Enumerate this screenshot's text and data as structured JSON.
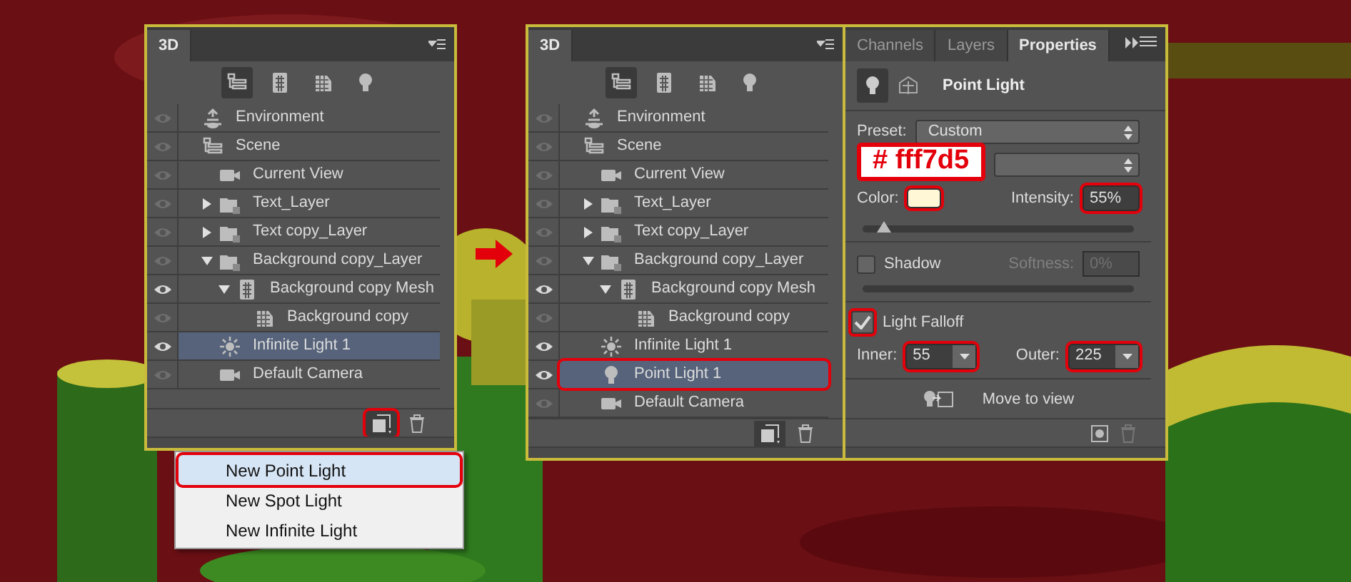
{
  "left_panel": {
    "tab": "3D",
    "filters": [
      {
        "kind": "scene",
        "selected": true
      },
      {
        "kind": "mesh",
        "selected": false
      },
      {
        "kind": "material",
        "selected": false
      },
      {
        "kind": "light",
        "selected": false
      }
    ],
    "items": [
      {
        "label": "Environment",
        "kind": "environment",
        "visible": false,
        "selected": false
      },
      {
        "label": "Scene",
        "kind": "scene",
        "visible": false,
        "selected": false,
        "children": [
          {
            "label": "Current View",
            "kind": "camera",
            "visible": false,
            "selected": false
          },
          {
            "label": "Text_Layer",
            "kind": "layer",
            "visible": false,
            "selected": false,
            "expanded": false
          },
          {
            "label": "Text copy_Layer",
            "kind": "layer",
            "visible": false,
            "selected": false,
            "expanded": false
          },
          {
            "label": "Background copy_Layer",
            "kind": "layer",
            "visible": false,
            "selected": false,
            "expanded": true,
            "children": [
              {
                "label": "Background copy Mesh",
                "kind": "mesh",
                "visible": true,
                "selected": false,
                "expanded": true,
                "children": [
                  {
                    "label": "Background copy",
                    "kind": "material",
                    "visible": false,
                    "selected": false
                  }
                ]
              }
            ]
          },
          {
            "label": "Infinite Light 1",
            "kind": "infinite-light",
            "visible": true,
            "selected": true
          },
          {
            "label": "Default Camera",
            "kind": "camera",
            "visible": false,
            "selected": false
          }
        ]
      }
    ],
    "new_light_highlighted": true,
    "menu": [
      {
        "label": "New Point Light",
        "selected": true,
        "highlighted": true
      },
      {
        "label": "New Spot Light",
        "selected": false,
        "highlighted": false
      },
      {
        "label": "New Infinite Light",
        "selected": false,
        "highlighted": false
      }
    ]
  },
  "middle_panel": {
    "tab": "3D",
    "filters": [
      {
        "kind": "scene",
        "selected": true
      },
      {
        "kind": "mesh",
        "selected": false
      },
      {
        "kind": "material",
        "selected": false
      },
      {
        "kind": "light",
        "selected": false
      }
    ],
    "items": [
      {
        "label": "Environment",
        "kind": "environment",
        "visible": false,
        "selected": false,
        "highlighted": false
      },
      {
        "label": "Scene",
        "kind": "scene",
        "visible": false,
        "selected": false,
        "children": [
          {
            "label": "Current View",
            "kind": "camera",
            "visible": false,
            "selected": false
          },
          {
            "label": "Text_Layer",
            "kind": "layer",
            "visible": false,
            "selected": false,
            "expanded": false
          },
          {
            "label": "Text copy_Layer",
            "kind": "layer",
            "visible": false,
            "selected": false,
            "expanded": false
          },
          {
            "label": "Background copy_Layer",
            "kind": "layer",
            "visible": false,
            "selected": false,
            "expanded": true,
            "children": [
              {
                "label": "Background copy Mesh",
                "kind": "mesh",
                "visible": true,
                "selected": false,
                "expanded": true,
                "children": [
                  {
                    "label": "Background copy",
                    "kind": "material",
                    "visible": false,
                    "selected": false
                  }
                ]
              }
            ]
          },
          {
            "label": "Infinite Light 1",
            "kind": "infinite-light",
            "visible": true,
            "selected": false
          },
          {
            "label": "Point Light 1",
            "kind": "point-light",
            "visible": true,
            "selected": true,
            "highlighted": true
          },
          {
            "label": "Default Camera",
            "kind": "camera",
            "visible": false,
            "selected": false
          }
        ]
      }
    ]
  },
  "properties_panel": {
    "tabs": [
      {
        "label": "Channels",
        "selected": false
      },
      {
        "label": "Layers",
        "selected": false
      },
      {
        "label": "Properties",
        "selected": true
      }
    ],
    "title": "Point Light",
    "preset_label": "Preset:",
    "preset_value": "Custom",
    "callout": "# fff7d5",
    "color_label": "Color:",
    "color": "#fff7d5",
    "color_highlighted": true,
    "intensity_label": "Intensity:",
    "intensity": "55%",
    "intensity_highlighted": true,
    "intensity_slider": {
      "level": 0.08
    },
    "shadow_label": "Shadow",
    "shadow_checked": false,
    "softness_label": "Softness:",
    "softness": "0%",
    "falloff_label": "Light Falloff",
    "falloff_checked": true,
    "falloff_highlighted": true,
    "inner_label": "Inner:",
    "inner": "55",
    "outer_label": "Outer:",
    "outer": "225",
    "falloff_values_highlighted": true,
    "move_label": "Move to view"
  }
}
